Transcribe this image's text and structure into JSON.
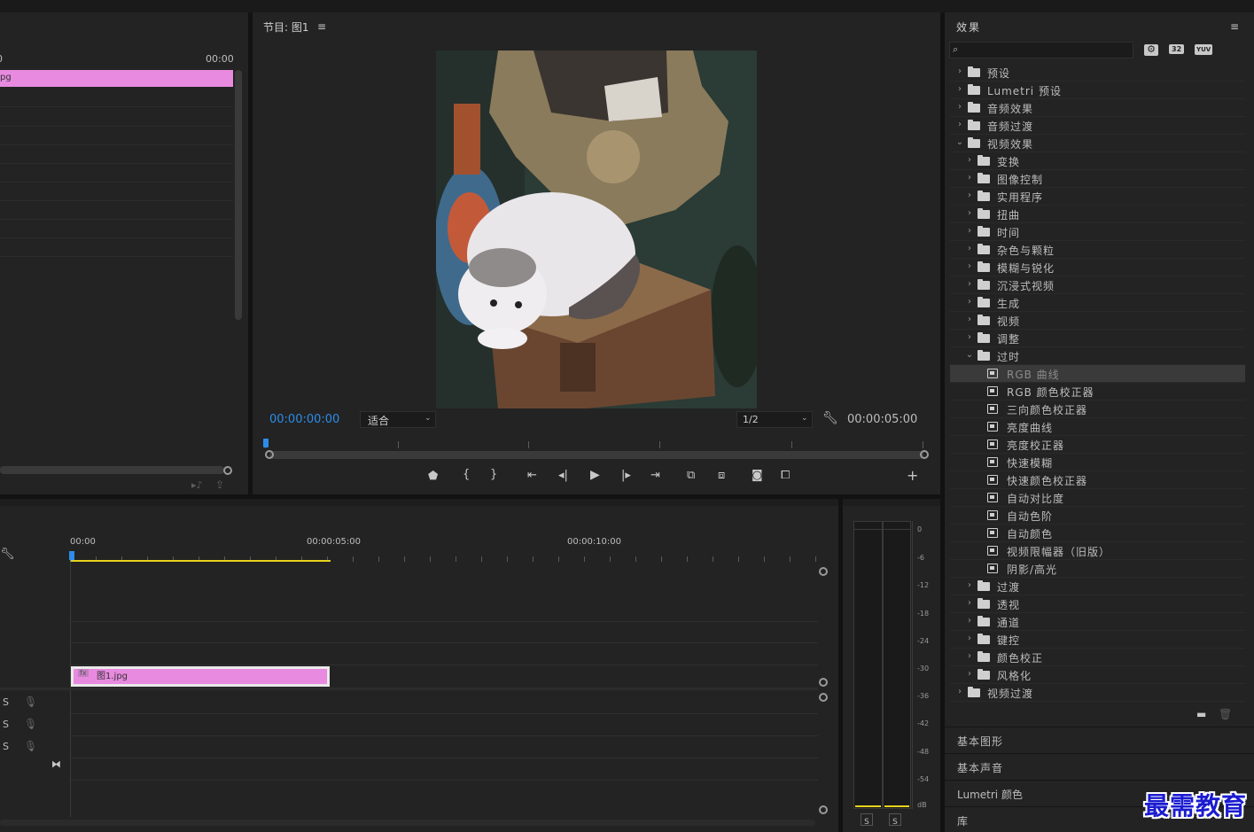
{
  "program_monitor": {
    "title": "节目: 图1",
    "menu_icon": "hamburger-icon",
    "timecode_current": "00:00:00:00",
    "timecode_duration": "00:00:05:00",
    "zoom_select": "适合",
    "resolution_select": "1/2",
    "buttons": [
      {
        "name": "add-marker-button",
        "icon": "marker-icon"
      },
      {
        "name": "mark-in-button",
        "icon": "brace-left-icon"
      },
      {
        "name": "mark-out-button",
        "icon": "brace-right-icon"
      },
      {
        "name": "go-to-in-button",
        "icon": "go-to-in-icon"
      },
      {
        "name": "step-back-button",
        "icon": "step-back-icon"
      },
      {
        "name": "play-button",
        "icon": "play-icon"
      },
      {
        "name": "step-forward-button",
        "icon": "step-forward-icon"
      },
      {
        "name": "go-to-out-button",
        "icon": "go-to-out-icon"
      },
      {
        "name": "lift-button",
        "icon": "lift-icon"
      },
      {
        "name": "extract-button",
        "icon": "extract-icon"
      },
      {
        "name": "export-frame-button",
        "icon": "camera-icon"
      },
      {
        "name": "compare-view-button",
        "icon": "compare-icon"
      }
    ]
  },
  "source_panel": {
    "timecode": "00:00",
    "clip_label": "pg"
  },
  "timeline": {
    "ruler": [
      "00:00",
      "00:00:05:00",
      "00:00:10:00"
    ],
    "clip_name": "图1.jpg",
    "clip_fx": "fx",
    "audio_track_labels": [
      "S",
      "S",
      "S"
    ]
  },
  "audio_meter": {
    "scale": [
      "0",
      "-6",
      "-12",
      "-18",
      "-24",
      "-30",
      "-36",
      "-42",
      "-48",
      "-54",
      "dB"
    ],
    "solo": [
      "S",
      "S"
    ]
  },
  "effects": {
    "title": "效果",
    "search_placeholder": "",
    "badges": [
      "32",
      "YUV"
    ],
    "tree": [
      {
        "label": "预设",
        "level": 0,
        "type": "folder-star",
        "expanded": false
      },
      {
        "label": "Lumetri 预设",
        "level": 0,
        "type": "folder-star",
        "expanded": false
      },
      {
        "label": "音频效果",
        "level": 0,
        "type": "folder",
        "expanded": false
      },
      {
        "label": "音频过渡",
        "level": 0,
        "type": "folder",
        "expanded": false
      },
      {
        "label": "视频效果",
        "level": 0,
        "type": "folder",
        "expanded": true
      },
      {
        "label": "变换",
        "level": 1,
        "type": "folder",
        "expanded": false
      },
      {
        "label": "图像控制",
        "level": 1,
        "type": "folder",
        "expanded": false
      },
      {
        "label": "实用程序",
        "level": 1,
        "type": "folder",
        "expanded": false
      },
      {
        "label": "扭曲",
        "level": 1,
        "type": "folder",
        "expanded": false
      },
      {
        "label": "时间",
        "level": 1,
        "type": "folder",
        "expanded": false
      },
      {
        "label": "杂色与颗粒",
        "level": 1,
        "type": "folder",
        "expanded": false
      },
      {
        "label": "模糊与锐化",
        "level": 1,
        "type": "folder",
        "expanded": false
      },
      {
        "label": "沉浸式视频",
        "level": 1,
        "type": "folder",
        "expanded": false
      },
      {
        "label": "生成",
        "level": 1,
        "type": "folder",
        "expanded": false
      },
      {
        "label": "视频",
        "level": 1,
        "type": "folder",
        "expanded": false
      },
      {
        "label": "调整",
        "level": 1,
        "type": "folder",
        "expanded": false
      },
      {
        "label": "过时",
        "level": 1,
        "type": "folder",
        "expanded": true
      },
      {
        "label": "RGB 曲线",
        "level": 2,
        "type": "effect",
        "selected": true
      },
      {
        "label": "RGB 颜色校正器",
        "level": 2,
        "type": "effect"
      },
      {
        "label": "三向颜色校正器",
        "level": 2,
        "type": "effect"
      },
      {
        "label": "亮度曲线",
        "level": 2,
        "type": "effect"
      },
      {
        "label": "亮度校正器",
        "level": 2,
        "type": "effect"
      },
      {
        "label": "快速模糊",
        "level": 2,
        "type": "effect"
      },
      {
        "label": "快速颜色校正器",
        "level": 2,
        "type": "effect"
      },
      {
        "label": "自动对比度",
        "level": 2,
        "type": "effect"
      },
      {
        "label": "自动色阶",
        "level": 2,
        "type": "effect"
      },
      {
        "label": "自动颜色",
        "level": 2,
        "type": "effect"
      },
      {
        "label": "视频限幅器（旧版）",
        "level": 2,
        "type": "effect"
      },
      {
        "label": "阴影/高光",
        "level": 2,
        "type": "effect"
      },
      {
        "label": "过渡",
        "level": 1,
        "type": "folder",
        "expanded": false
      },
      {
        "label": "透视",
        "level": 1,
        "type": "folder",
        "expanded": false
      },
      {
        "label": "通道",
        "level": 1,
        "type": "folder",
        "expanded": false
      },
      {
        "label": "键控",
        "level": 1,
        "type": "folder",
        "expanded": false
      },
      {
        "label": "颜色校正",
        "level": 1,
        "type": "folder",
        "expanded": false
      },
      {
        "label": "风格化",
        "level": 1,
        "type": "folder",
        "expanded": false
      },
      {
        "label": "视频过渡",
        "level": 0,
        "type": "folder",
        "expanded": false
      }
    ]
  },
  "collapsed_panels": [
    "基本图形",
    "基本声音",
    "Lumetri 颜色",
    "库"
  ],
  "watermark": "最需教育",
  "colors": {
    "accent_blue": "#2d8ceb",
    "clip_pink": "#e88ae0",
    "playhead_yellow": "#e8d21d",
    "panel_bg": "#232323"
  }
}
